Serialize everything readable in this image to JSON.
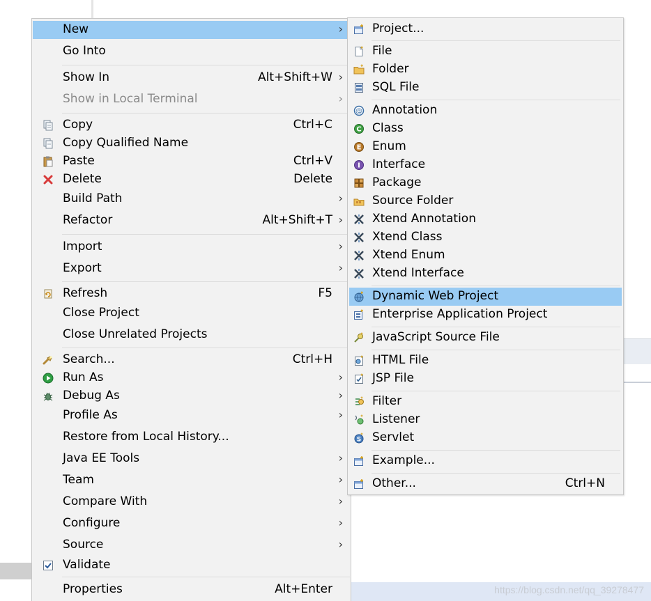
{
  "main_menu": {
    "new": {
      "label": "New"
    },
    "go_into": {
      "label": "Go Into"
    },
    "show_in": {
      "label": "Show In",
      "shortcut": "Alt+Shift+W"
    },
    "show_in_local_terminal": {
      "label": "Show in Local Terminal"
    },
    "copy": {
      "label": "Copy",
      "shortcut": "Ctrl+C"
    },
    "copy_qualified_name": {
      "label": "Copy Qualified Name"
    },
    "paste": {
      "label": "Paste",
      "shortcut": "Ctrl+V"
    },
    "delete": {
      "label": "Delete",
      "shortcut": "Delete"
    },
    "build_path": {
      "label": "Build Path"
    },
    "refactor": {
      "label": "Refactor",
      "shortcut": "Alt+Shift+T"
    },
    "import": {
      "label": "Import"
    },
    "export": {
      "label": "Export"
    },
    "refresh": {
      "label": "Refresh",
      "shortcut": "F5"
    },
    "close_project": {
      "label": "Close Project"
    },
    "close_unrelated_projects": {
      "label": "Close Unrelated Projects"
    },
    "search": {
      "label": "Search...",
      "shortcut": "Ctrl+H"
    },
    "run_as": {
      "label": "Run As"
    },
    "debug_as": {
      "label": "Debug As"
    },
    "profile_as": {
      "label": "Profile As"
    },
    "restore_local_history": {
      "label": "Restore from Local History..."
    },
    "java_ee_tools": {
      "label": "Java EE Tools"
    },
    "team": {
      "label": "Team"
    },
    "compare_with": {
      "label": "Compare With"
    },
    "configure": {
      "label": "Configure"
    },
    "source": {
      "label": "Source"
    },
    "validate": {
      "label": "Validate"
    },
    "properties": {
      "label": "Properties",
      "shortcut": "Alt+Enter"
    }
  },
  "sub_menu": {
    "project": {
      "label": "Project..."
    },
    "file": {
      "label": "File"
    },
    "folder": {
      "label": "Folder"
    },
    "sql_file": {
      "label": "SQL File"
    },
    "annotation": {
      "label": "Annotation"
    },
    "class": {
      "label": "Class"
    },
    "enum": {
      "label": "Enum"
    },
    "interface": {
      "label": "Interface"
    },
    "package": {
      "label": "Package"
    },
    "source_folder": {
      "label": "Source Folder"
    },
    "xtend_annotation": {
      "label": "Xtend Annotation"
    },
    "xtend_class": {
      "label": "Xtend Class"
    },
    "xtend_enum": {
      "label": "Xtend Enum"
    },
    "xtend_interface": {
      "label": "Xtend Interface"
    },
    "dynamic_web_project": {
      "label": "Dynamic Web Project"
    },
    "enterprise_application_project": {
      "label": "Enterprise Application Project"
    },
    "javascript_source_file": {
      "label": "JavaScript Source File"
    },
    "html_file": {
      "label": "HTML File"
    },
    "jsp_file": {
      "label": "JSP File"
    },
    "filter": {
      "label": "Filter"
    },
    "listener": {
      "label": "Listener"
    },
    "servlet": {
      "label": "Servlet"
    },
    "example": {
      "label": "Example..."
    },
    "other": {
      "label": "Other...",
      "shortcut": "Ctrl+N"
    }
  },
  "submenu_arrow": "›",
  "watermark": "https://blog.csdn.net/qq_39278477",
  "colors": {
    "menu_bg": "#f2f2f2",
    "highlight": "#99cbf3",
    "separator": "#dcdcdc",
    "disabled_text": "#8a8a8a"
  }
}
